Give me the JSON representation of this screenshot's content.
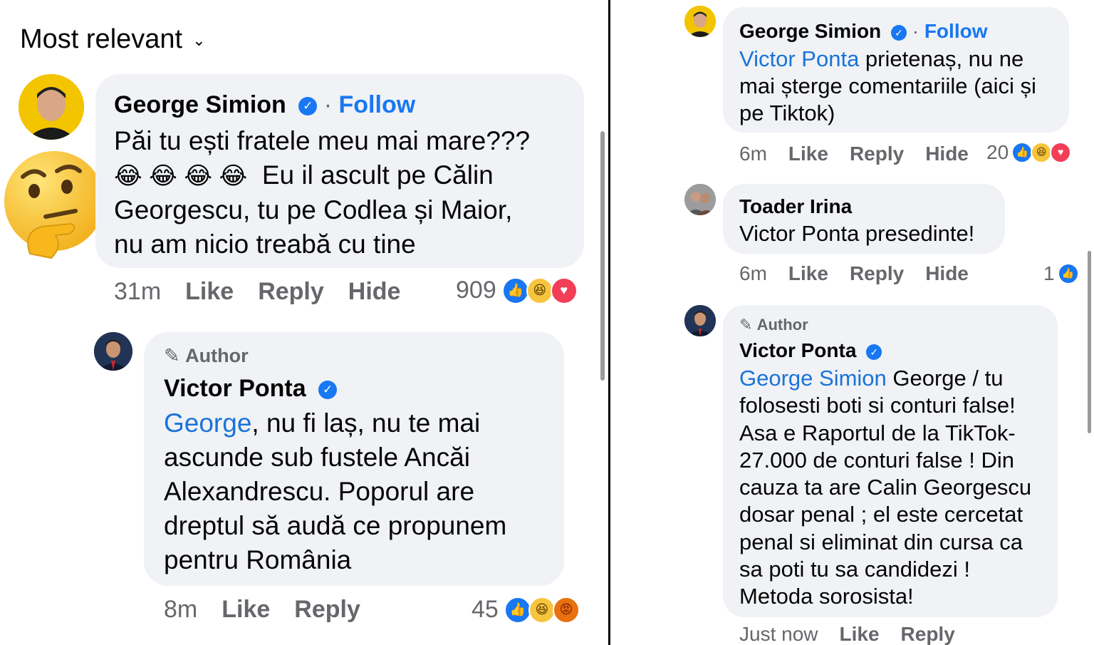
{
  "left": {
    "sort_label": "Most relevant",
    "comment1": {
      "name": "George Simion",
      "follow": "Follow",
      "text": "Păi tu ești fratele meu mai mare??? 😂😂😂😂 Eu il ascult pe Călin Georgescu, tu pe Codlea și Maior, nu am nicio treabă cu tine",
      "line1": "Păi tu ești fratele meu mai mare???",
      "line2_emoji": "😂 😂 😂 😂",
      "line2_text": "Eu il ascult pe Călin",
      "line3": "Georgescu, tu pe Codlea și Maior,",
      "line4": "nu am nicio treabă cu tine",
      "time": "31m",
      "like": "Like",
      "reply": "Reply",
      "hide": "Hide",
      "reaction_count": "909"
    },
    "comment2": {
      "author_badge": "Author",
      "name": "Victor Ponta",
      "mention": "George",
      "line1_rest": ", nu fi laș, nu te mai",
      "line2": "ascunde sub fustele Ancăi",
      "line3": "Alexandrescu. Poporul are",
      "line4": "dreptul să audă ce propunem",
      "line5": "pentru România",
      "time": "8m",
      "like": "Like",
      "reply": "Reply",
      "reaction_count": "45"
    }
  },
  "right": {
    "comment1": {
      "name": "George Simion",
      "follow": "Follow",
      "mention": "Victor Ponta",
      "line1_rest": " prietenaș, nu ne",
      "line2": "mai șterge comentariile (aici și",
      "line3": "pe Tiktok)",
      "time": "6m",
      "like": "Like",
      "reply": "Reply",
      "hide": "Hide",
      "reaction_count": "20"
    },
    "comment2": {
      "name": "Toader Irina",
      "text": "Victor Ponta presedinte!",
      "time": "6m",
      "like": "Like",
      "reply": "Reply",
      "hide": "Hide",
      "reaction_count": "1"
    },
    "comment3": {
      "author_badge": "Author",
      "name": "Victor Ponta",
      "mention": "George Simion",
      "line1_rest": " George / tu",
      "line2": "folosesti boti si conturi false!",
      "line3": "Asa e Raportul de la TikTok-",
      "line4": "27.000 de conturi false ! Din",
      "line5": "cauza ta are Calin Georgescu",
      "line6": "dosar penal ; el este cercetat",
      "line7": "penal si eliminat din cursa ca",
      "line8": "sa poti tu sa candidezi !",
      "line9": "Metoda sorosista!",
      "time": "Just now",
      "like": "Like",
      "reply": "Reply"
    }
  },
  "colors": {
    "link": "#1a73d9",
    "verified": "#1877f2",
    "bubble": "#f0f2f5",
    "meta": "#65676b"
  }
}
